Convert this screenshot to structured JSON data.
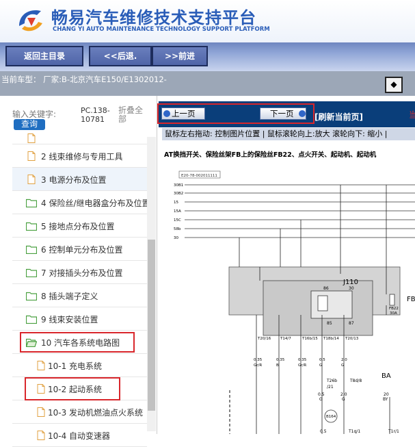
{
  "header": {
    "title_cn": "畅易汽车维修技术支持平台",
    "title_en": "CHANG YI AUTO MAINTENANCE TECHNOLOGY SUPPORT PLATFORM",
    "logo_icon": "ce-logo-icon"
  },
  "nav": {
    "home_label": "返回主目录",
    "back_label": "<<后退.",
    "forward_label": ">>前进"
  },
  "car": {
    "info": "当前车型：  厂家:B-北京汽车E150/E1302012-"
  },
  "sidebar": {
    "search_label": "输入关键字:",
    "search_button": "查询",
    "pc_code": "PC.138-10781",
    "collapse_all": "折叠全部",
    "items": [
      {
        "label": "2 线束维修与专用工具",
        "icon": "file-icon"
      },
      {
        "label": "3 电源分布及位置",
        "icon": "file-icon"
      },
      {
        "label": "4 保险丝/继电器盒分布及位置",
        "icon": "folder-icon"
      },
      {
        "label": "5 接地点分布及位置",
        "icon": "folder-icon"
      },
      {
        "label": "6 控制单元分布及位置",
        "icon": "folder-icon"
      },
      {
        "label": "7 对接插头分布及位置",
        "icon": "folder-icon"
      },
      {
        "label": "8 插头端子定义",
        "icon": "folder-icon"
      },
      {
        "label": "9 线束安装位置",
        "icon": "folder-icon"
      },
      {
        "label": "10 汽车各系统电路图",
        "icon": "folder-open-icon"
      },
      {
        "label": "10-1 充电系统",
        "icon": "file-icon"
      },
      {
        "label": "10-2 起动系统",
        "icon": "file-icon"
      },
      {
        "label": "10-3 发动机燃油点火系统",
        "icon": "file-icon"
      },
      {
        "label": "10-4 自动变速器",
        "icon": "file-icon"
      }
    ]
  },
  "pager": {
    "prev_label": "上一页",
    "next_label": "下一页",
    "refresh_label": "[刷新当前页]",
    "red_mark": "当"
  },
  "hint": {
    "text": "鼠标左右拖动: 控制图片位置 | 鼠标滚轮向上:放大  滚轮向下: 缩小 |"
  },
  "diagram": {
    "title": "AT换挡开关、保险丝架FB上的保险丝FB22、点火开关、起动机、起动机",
    "ref_code": "E20-78-002011111",
    "bus_labels": [
      "30B1",
      "30B2",
      "15",
      "15A",
      "15C",
      "58b",
      "30"
    ],
    "component": "J110",
    "relay_pins": [
      "86",
      "30",
      "85",
      "87"
    ],
    "box_label": "FB",
    "fuse_label": "FB22",
    "fuse_rating": "30A",
    "connectors": [
      "T20/16",
      "T14/7",
      "T16b/15",
      "T18b/14",
      "T20/13"
    ],
    "wire_sizes": [
      "0.35",
      "0.35",
      "0.35",
      "0.5",
      "2.0"
    ],
    "wire_colors": [
      "Gr/R",
      "B",
      "Gr/R",
      "G",
      "G"
    ],
    "t26b": "T26b",
    "t26b_pin": "/21",
    "t8d": "T8d/8",
    "wire2_size": "0.5",
    "wire2_color": "G",
    "wire2b_size": "2.0",
    "wire2b_color": "G",
    "ba": "BA",
    "ba_size": "20",
    "ba_color": "BY",
    "b164": "B164",
    "t1q": "T1q/1",
    "t1r": "T1r/1",
    "bottom_size": "0.5"
  }
}
